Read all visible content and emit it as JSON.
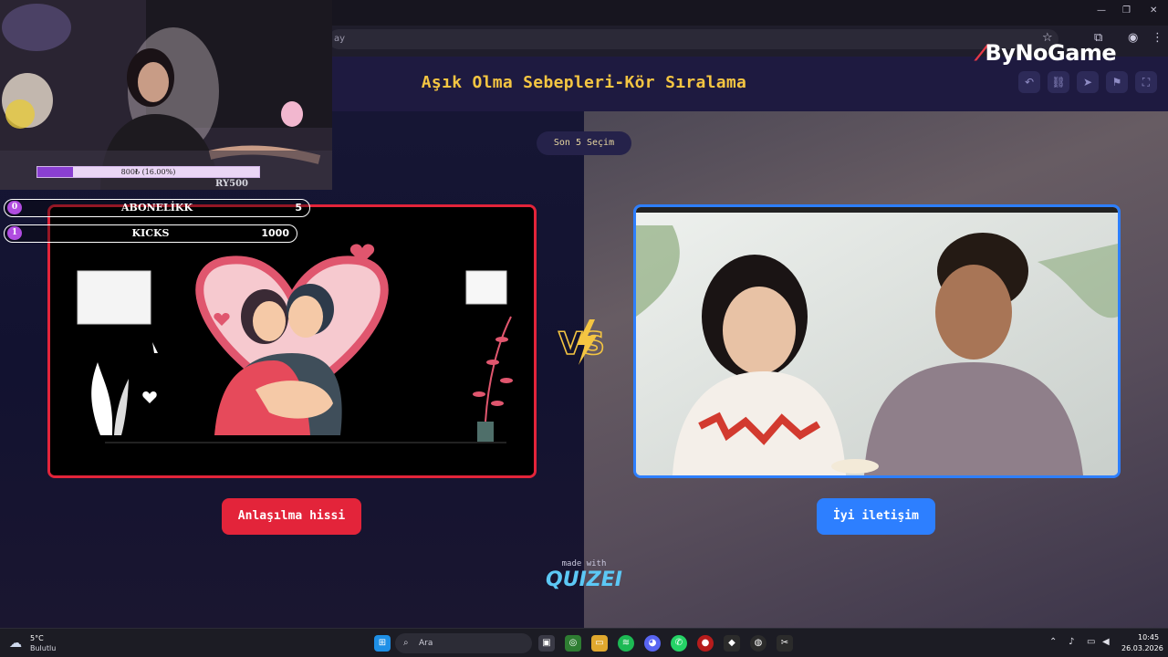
{
  "browser": {
    "url_fragment": "ay"
  },
  "brand": {
    "name": "ByNoGame"
  },
  "quiz": {
    "title": "Aşık Olma Sebepleri-Kör Sıralama",
    "round_label": "Son 5 Seçim",
    "left_choice": "Anlaşılma hissi",
    "right_choice": "İyi iletişim",
    "made_with": "made with",
    "maker": "QUIZEI",
    "accent_left": "#e3243a",
    "accent_right": "#2d7fff",
    "title_color": "#f4c542"
  },
  "stream_overlay": {
    "progress_text": "800₺ (16.00%)",
    "progress_fraction": 0.16,
    "partial_text": "RY500",
    "goals": [
      {
        "rank": "0",
        "label": "ABONELİKK",
        "value": "5"
      },
      {
        "rank": "1",
        "label": "KICKS",
        "value": "1000"
      }
    ]
  },
  "taskbar": {
    "weather_temp": "5°C",
    "weather_desc": "Bulutlu",
    "search_placeholder": "Ara",
    "time": "10:45",
    "date": "26.03.2026"
  }
}
